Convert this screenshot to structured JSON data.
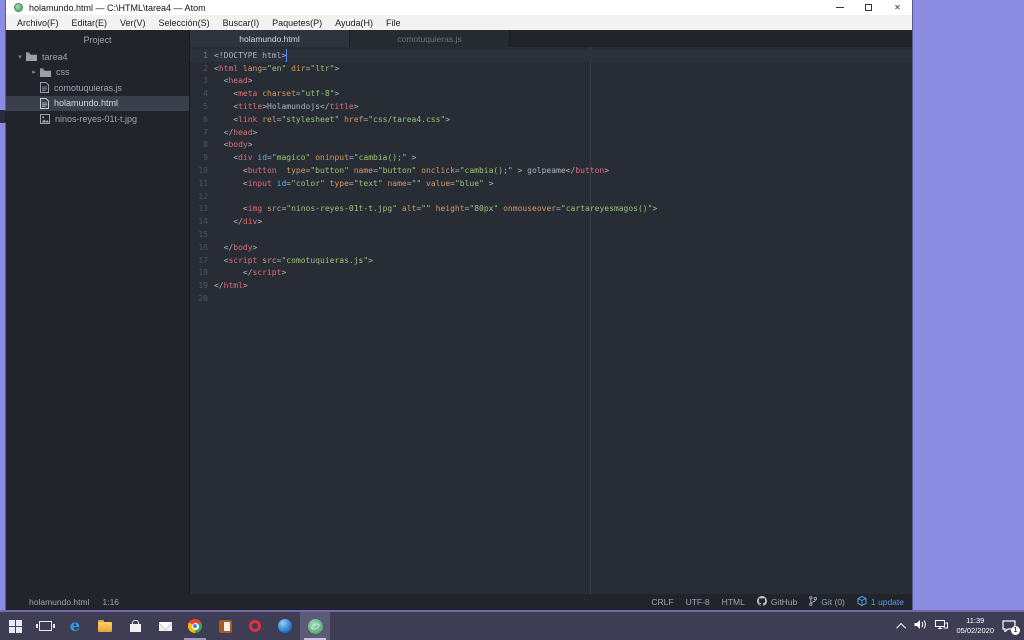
{
  "window": {
    "title": "holamundo.html — C:\\HTML\\tarea4 — Atom"
  },
  "menu": {
    "items": [
      "Archivo(F)",
      "Editar(E)",
      "Ver(V)",
      "Selección(S)",
      "Buscar(I)",
      "Paquetes(P)",
      "Ayuda(H)",
      "File"
    ]
  },
  "tree": {
    "header": "Project",
    "items": [
      {
        "label": "tarea4",
        "type": "folder-open",
        "expanded": true
      },
      {
        "label": "css",
        "type": "folder-collapsed"
      },
      {
        "label": "comotuquieras.js",
        "type": "file"
      },
      {
        "label": "holamundo.html",
        "type": "file",
        "selected": true
      },
      {
        "label": "ninos-reyes-01t-t.jpg",
        "type": "image"
      }
    ]
  },
  "tabs": [
    {
      "label": "holamundo.html",
      "active": true
    },
    {
      "label": "comotuquieras.js",
      "active": false
    }
  ],
  "editor": {
    "active_line": 1,
    "total_lines": 20,
    "lines": [
      [
        [
          "p",
          "<!DOCTYPE html>"
        ]
      ],
      [
        [
          "p",
          "<"
        ],
        [
          "t",
          "html"
        ],
        [
          "p",
          " "
        ],
        [
          "a",
          "lang"
        ],
        [
          "p",
          "="
        ],
        [
          "s",
          "\"en\""
        ],
        [
          "p",
          " "
        ],
        [
          "a",
          "dir"
        ],
        [
          "p",
          "="
        ],
        [
          "s",
          "\"ltr\""
        ],
        [
          "p",
          ">"
        ]
      ],
      [
        [
          "p",
          "  <"
        ],
        [
          "t",
          "head"
        ],
        [
          "p",
          ">"
        ]
      ],
      [
        [
          "p",
          "    <"
        ],
        [
          "t",
          "meta"
        ],
        [
          "p",
          " "
        ],
        [
          "a",
          "charset"
        ],
        [
          "p",
          "="
        ],
        [
          "s",
          "\"utf-8\""
        ],
        [
          "p",
          ">"
        ]
      ],
      [
        [
          "p",
          "    <"
        ],
        [
          "t",
          "title"
        ],
        [
          "p",
          ">Holamundojs</"
        ],
        [
          "t",
          "title"
        ],
        [
          "p",
          ">"
        ]
      ],
      [
        [
          "p",
          "    <"
        ],
        [
          "t",
          "link"
        ],
        [
          "p",
          " "
        ],
        [
          "a",
          "rel"
        ],
        [
          "p",
          "="
        ],
        [
          "s",
          "\"stylesheet\""
        ],
        [
          "p",
          " "
        ],
        [
          "a",
          "href"
        ],
        [
          "p",
          "="
        ],
        [
          "s",
          "\"css/tarea4.css\""
        ],
        [
          "p",
          ">"
        ]
      ],
      [
        [
          "p",
          "  </"
        ],
        [
          "t",
          "head"
        ],
        [
          "p",
          ">"
        ]
      ],
      [
        [
          "p",
          "  <"
        ],
        [
          "t",
          "body"
        ],
        [
          "p",
          ">"
        ]
      ],
      [
        [
          "p",
          "    <"
        ],
        [
          "t",
          "div"
        ],
        [
          "p",
          " "
        ],
        [
          "i",
          "id"
        ],
        [
          "p",
          "="
        ],
        [
          "s",
          "\"magico\""
        ],
        [
          "p",
          " "
        ],
        [
          "a",
          "oninput"
        ],
        [
          "p",
          "="
        ],
        [
          "s",
          "\"cambia();\""
        ],
        [
          "p",
          " >"
        ]
      ],
      [
        [
          "p",
          "      <"
        ],
        [
          "t",
          "button"
        ],
        [
          "p",
          "  "
        ],
        [
          "a",
          "type"
        ],
        [
          "p",
          "="
        ],
        [
          "s",
          "\"button\""
        ],
        [
          "p",
          " "
        ],
        [
          "a",
          "name"
        ],
        [
          "p",
          "="
        ],
        [
          "s",
          "\"button\""
        ],
        [
          "p",
          " "
        ],
        [
          "a",
          "onclick"
        ],
        [
          "p",
          "="
        ],
        [
          "s",
          "\"cambia();\""
        ],
        [
          "p",
          " > golpeame</"
        ],
        [
          "t",
          "button"
        ],
        [
          "p",
          ">"
        ]
      ],
      [
        [
          "p",
          "      <"
        ],
        [
          "t",
          "input"
        ],
        [
          "p",
          " "
        ],
        [
          "i",
          "id"
        ],
        [
          "p",
          "="
        ],
        [
          "s",
          "\"color\""
        ],
        [
          "p",
          " "
        ],
        [
          "a",
          "type"
        ],
        [
          "p",
          "="
        ],
        [
          "s",
          "\"text\""
        ],
        [
          "p",
          " "
        ],
        [
          "a",
          "name"
        ],
        [
          "p",
          "="
        ],
        [
          "s",
          "\"\""
        ],
        [
          "p",
          " "
        ],
        [
          "a",
          "value"
        ],
        [
          "p",
          "="
        ],
        [
          "s",
          "\"blue\""
        ],
        [
          "p",
          " >"
        ]
      ],
      [],
      [
        [
          "p",
          "      <"
        ],
        [
          "t",
          "img"
        ],
        [
          "p",
          " "
        ],
        [
          "a",
          "src"
        ],
        [
          "p",
          "="
        ],
        [
          "s",
          "\"ninos-reyes-01t-t.jpg\""
        ],
        [
          "p",
          " "
        ],
        [
          "a",
          "alt"
        ],
        [
          "p",
          "="
        ],
        [
          "s",
          "\"\""
        ],
        [
          "p",
          " "
        ],
        [
          "a",
          "height"
        ],
        [
          "p",
          "="
        ],
        [
          "s",
          "\"80px\""
        ],
        [
          "p",
          " "
        ],
        [
          "a",
          "onmouseover"
        ],
        [
          "p",
          "="
        ],
        [
          "s",
          "\"cartareyesmagos()\""
        ],
        [
          "p",
          ">"
        ]
      ],
      [
        [
          "p",
          "    </"
        ],
        [
          "t",
          "div"
        ],
        [
          "p",
          ">"
        ]
      ],
      [],
      [
        [
          "p",
          "  </"
        ],
        [
          "t",
          "body"
        ],
        [
          "p",
          ">"
        ]
      ],
      [
        [
          "p",
          "  <"
        ],
        [
          "t",
          "script"
        ],
        [
          "p",
          " "
        ],
        [
          "a",
          "src"
        ],
        [
          "p",
          "="
        ],
        [
          "s",
          "\"comotuquieras.js\""
        ],
        [
          "p",
          ">"
        ]
      ],
      [
        [
          "p",
          "      </"
        ],
        [
          "t",
          "script"
        ],
        [
          "p",
          ">"
        ]
      ],
      [
        [
          "p",
          "</"
        ],
        [
          "t",
          "html"
        ],
        [
          "p",
          ">"
        ]
      ],
      []
    ]
  },
  "statusbar": {
    "file": "holamundo.html",
    "position": "1:16",
    "eol": "CRLF",
    "encoding": "UTF-8",
    "grammar": "HTML",
    "github_label": "GitHub",
    "git_label": "Git (0)",
    "update_label": "1 update"
  },
  "taskbar": {
    "icons": [
      "start",
      "task-view",
      "edge",
      "file-explorer",
      "store",
      "mail",
      "chrome",
      "office-document",
      "opera",
      "blue-sphere-app",
      "atom"
    ],
    "tray": {
      "time": "11:39",
      "date": "05/02/2020",
      "badge": "1"
    }
  },
  "colors": {
    "desktop": "#8b8be2",
    "taskbar": "#3e3d54",
    "taskbar_border": "#7668ab",
    "editor_bg": "#282c34",
    "panel_bg": "#21252b",
    "selection_bg": "#3a3f4b",
    "status_blue": "#5c9ce6",
    "syntax": {
      "plain": "#abb2bf",
      "tag": "#e06c75",
      "attr": "#d19a66",
      "id_attr": "#61afef",
      "string": "#98c379"
    }
  }
}
